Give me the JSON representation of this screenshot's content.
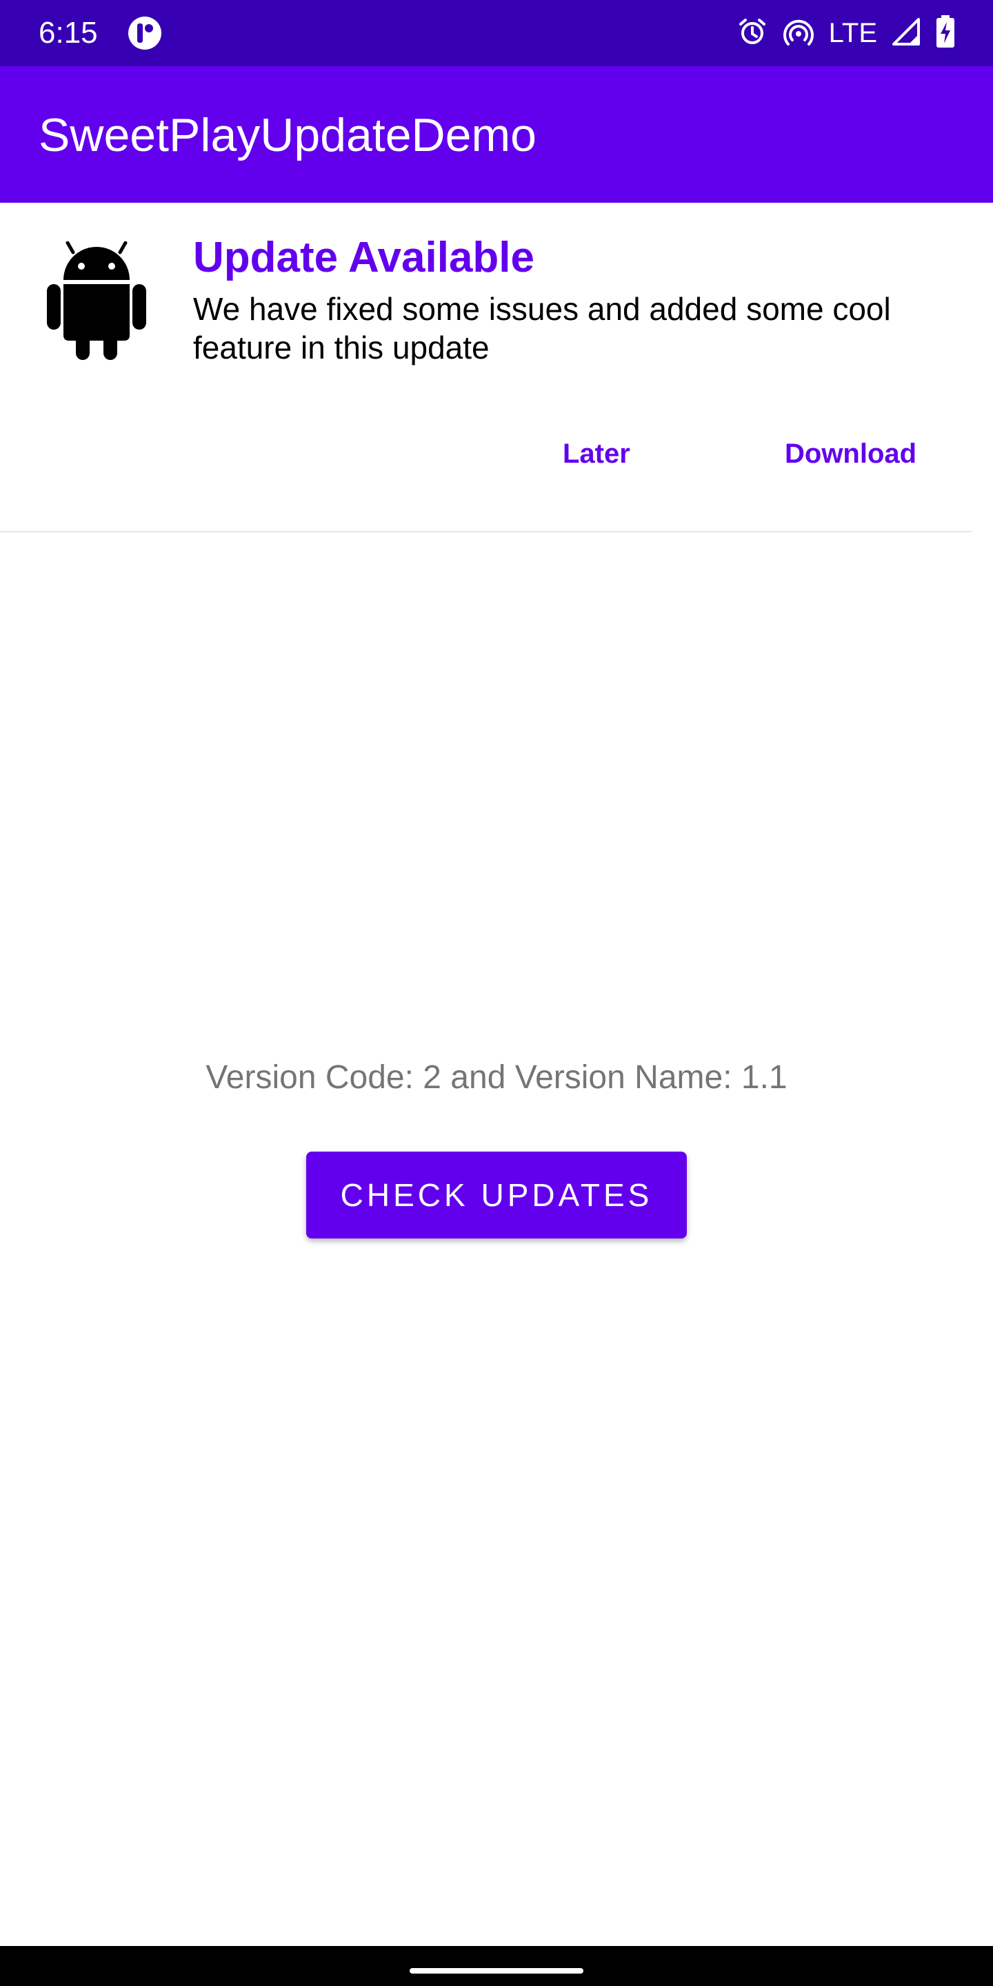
{
  "status_bar": {
    "time": "6:15",
    "network": "LTE",
    "background_color": "#3700b3",
    "icons": [
      "app-notification-icon",
      "alarm-icon",
      "hotspot-icon",
      "signal-icon",
      "battery-charging-icon"
    ]
  },
  "app_bar": {
    "title": "SweetPlayUpdateDemo",
    "background_color": "#6200ee"
  },
  "update_banner": {
    "icon": "android-icon",
    "title": "Update Available",
    "message": "We have fixed some issues and added some cool feature in this update",
    "later_label": "Later",
    "download_label": "Download",
    "accent_color": "#6200ee"
  },
  "main": {
    "version_text": "Version Code: 2 and Version Name: 1.1",
    "check_button_label": "CHECK UPDATES"
  },
  "nav_bar": {
    "handle": "home-handle"
  }
}
